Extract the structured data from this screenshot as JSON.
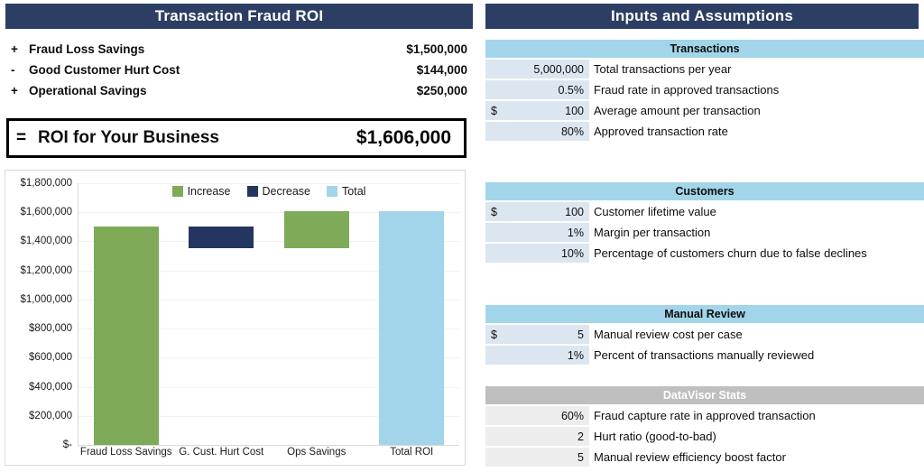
{
  "left_panel": {
    "title": "Transaction Fraud ROI",
    "lines": [
      {
        "sign": "+",
        "label": "Fraud Loss Savings",
        "amount": "$1,500,000"
      },
      {
        "sign": "-",
        "label": "Good Customer Hurt Cost",
        "amount": "$144,000"
      },
      {
        "sign": "+",
        "label": "Operational Savings",
        "amount": "$250,000"
      }
    ],
    "total": {
      "sign": "=",
      "label": "ROI for Your Business",
      "amount": "$1,606,000"
    }
  },
  "chart_data": {
    "type": "bar",
    "subtype": "waterfall",
    "title": "",
    "xlabel": "",
    "ylabel": "",
    "ylim": [
      0,
      1800000
    ],
    "grid": true,
    "legend_position": "top-center",
    "legend": [
      {
        "name": "Increase",
        "color": "#7fab58"
      },
      {
        "name": "Decrease",
        "color": "#24365f"
      },
      {
        "name": "Total",
        "color": "#a2d5e9"
      }
    ],
    "ytick_labels": [
      "$1,800,000",
      "$1,600,000",
      "$1,400,000",
      "$1,200,000",
      "$1,000,000",
      "$800,000",
      "$600,000",
      "$400,000",
      "$200,000",
      "$-"
    ],
    "ytick_values": [
      1800000,
      1600000,
      1400000,
      1200000,
      1000000,
      800000,
      600000,
      400000,
      200000,
      0
    ],
    "categories": [
      "Fraud Loss Savings",
      "G. Cust. Hurt Cost",
      "Ops Savings",
      "Total ROI"
    ],
    "bars": [
      {
        "category": "Fraud Loss Savings",
        "base": 0,
        "top": 1500000,
        "value": 1500000,
        "series": "Increase",
        "color": "#7fab58"
      },
      {
        "category": "G. Cust. Hurt Cost",
        "base": 1356000,
        "top": 1500000,
        "value": -144000,
        "series": "Decrease",
        "color": "#24365f"
      },
      {
        "category": "Ops Savings",
        "base": 1356000,
        "top": 1606000,
        "value": 250000,
        "series": "Increase",
        "color": "#7fab58"
      },
      {
        "category": "Total ROI",
        "base": 0,
        "top": 1606000,
        "value": 1606000,
        "series": "Total",
        "color": "#a2d5e9"
      }
    ]
  },
  "right_panel": {
    "title": "Inputs and Assumptions",
    "sections": [
      {
        "name": "Transactions",
        "style": "blue",
        "rows": [
          {
            "currency": "",
            "value": "5,000,000",
            "description": "Total transactions per year"
          },
          {
            "currency": "",
            "value": "0.5%",
            "description": "Fraud rate in approved transactions"
          },
          {
            "currency": "$",
            "value": "100",
            "description": "Average amount per transaction"
          },
          {
            "currency": "",
            "value": "80%",
            "description": "Approved transaction rate"
          }
        ]
      },
      {
        "name": "Customers",
        "style": "blue",
        "rows": [
          {
            "currency": "$",
            "value": "100",
            "description": "Customer lifetime value"
          },
          {
            "currency": "",
            "value": "1%",
            "description": "Margin per transaction"
          },
          {
            "currency": "",
            "value": "10%",
            "description": "Percentage of customers churn due to false declines"
          }
        ]
      },
      {
        "name": "Manual Review",
        "style": "blue",
        "rows": [
          {
            "currency": "$",
            "value": "5",
            "description": "Manual review cost per case"
          },
          {
            "currency": "",
            "value": "1%",
            "description": "Percent of transactions manually reviewed"
          }
        ]
      },
      {
        "name": "DataVisor Stats",
        "style": "gray",
        "rows": [
          {
            "currency": "",
            "value": "60%",
            "description": "Fraud capture rate in approved transaction"
          },
          {
            "currency": "",
            "value": "2",
            "description": "Hurt ratio (good-to-bad)"
          },
          {
            "currency": "",
            "value": "5",
            "description": "Manual review efficiency boost factor"
          }
        ]
      }
    ]
  },
  "colors": {
    "header_navy": "#2c3e63",
    "increase_green": "#7fab58",
    "decrease_navy": "#24365f",
    "total_lightblue": "#a2d5e9",
    "section_blue": "#a2d5e9",
    "section_gray": "#bfbfbf",
    "value_cell_blue": "#dce6f0",
    "value_cell_gray": "#ededed"
  }
}
